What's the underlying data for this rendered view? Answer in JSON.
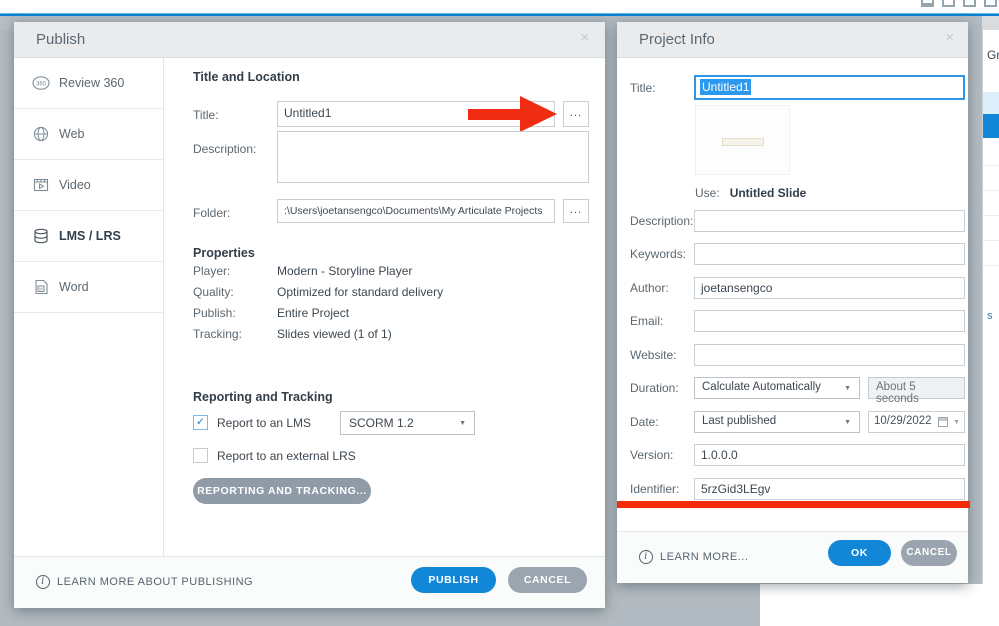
{
  "window": {
    "control_icons": [
      "minimize-icon",
      "maximize-icon",
      "restore-icon",
      "close-icon"
    ]
  },
  "background": {
    "partial_text_top_right": "Gr",
    "partial_link_right": "s"
  },
  "colors": {
    "accent_blue": "#1287d8",
    "red_annotation": "#f02c12",
    "cancel_gray": "#9aa5b0",
    "header_gray": "#e9ebed",
    "backdrop_gray": "#b2bbc1",
    "selection_blue": "#2b99ee"
  },
  "publish": {
    "title": "Publish",
    "close_icon": "×",
    "sidebar": [
      {
        "label": "Review 360",
        "icon": "review-360-icon"
      },
      {
        "label": "Web",
        "icon": "globe-icon"
      },
      {
        "label": "Video",
        "icon": "video-icon"
      },
      {
        "label": "LMS / LRS",
        "icon": "database-icon"
      },
      {
        "label": "Word",
        "icon": "word-doc-icon"
      }
    ],
    "title_location": {
      "heading": "Title and Location",
      "title_label": "Title:",
      "title_value": "Untitled1",
      "browse_label": "...",
      "description_label": "Description:",
      "description_value": "",
      "folder_label": "Folder:",
      "folder_value": ":\\Users\\joetansengco\\Documents\\My Articulate Projects"
    },
    "properties": {
      "heading": "Properties",
      "rows": [
        {
          "label": "Player:",
          "value": "Modern - Storyline Player"
        },
        {
          "label": "Quality:",
          "value": "Optimized for standard delivery"
        },
        {
          "label": "Publish:",
          "value": "Entire Project"
        },
        {
          "label": "Tracking:",
          "value": "Slides viewed (1 of 1)"
        }
      ]
    },
    "reporting": {
      "heading": "Reporting and Tracking",
      "lms_label": "Report to an LMS",
      "lms_checked": true,
      "scorm_value": "SCORM 1.2",
      "lrs_label": "Report to an external LRS",
      "lrs_checked": false,
      "button_label": "REPORTING AND TRACKING..."
    },
    "footer": {
      "learn_more": "LEARN MORE ABOUT PUBLISHING",
      "publish": "PUBLISH",
      "cancel": "CANCEL"
    }
  },
  "project_info": {
    "title": "Project Info",
    "close_icon": "×",
    "title_label": "Title:",
    "title_value": "Untitled1",
    "use_label": "Use:",
    "use_value": "Untitled Slide",
    "fields": {
      "description": {
        "label": "Description:",
        "value": ""
      },
      "keywords": {
        "label": "Keywords:",
        "value": ""
      },
      "author": {
        "label": "Author:",
        "value": "joetansengco"
      },
      "email": {
        "label": "Email:",
        "value": ""
      },
      "website": {
        "label": "Website:",
        "value": ""
      },
      "duration": {
        "label": "Duration:",
        "select_value": "Calculate Automatically",
        "info_value": "About 5 seconds"
      },
      "date": {
        "label": "Date:",
        "select_value": "Last published",
        "date_value": "10/29/2022"
      },
      "version": {
        "label": "Version:",
        "value": "1.0.0.0"
      },
      "identifier": {
        "label": "Identifier:",
        "value": "5rzGid3LEgv"
      }
    },
    "footer": {
      "learn_more": "LEARN MORE...",
      "ok": "OK",
      "cancel": "CANCEL"
    }
  }
}
